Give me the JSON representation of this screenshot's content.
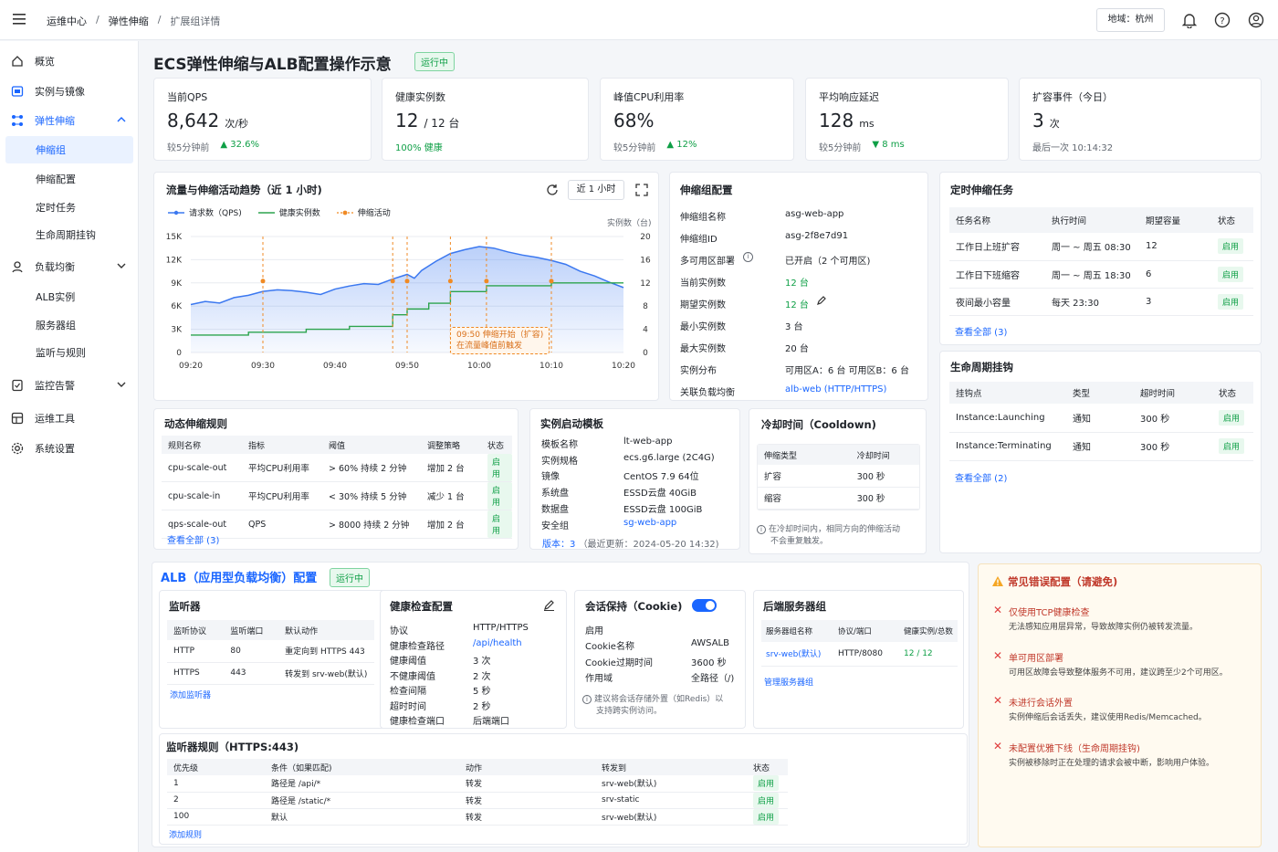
{
  "header": {
    "breadcrumb": [
      "运维中心",
      "弹性伸缩",
      "扩展组详情"
    ],
    "region": "地域：杭州"
  },
  "sidebar": {
    "items": [
      {
        "label": "概览",
        "icon": "overview-icon"
      },
      {
        "label": "实例与镜像",
        "icon": "instance-icon"
      },
      {
        "label": "弹性伸缩",
        "icon": "scaling-icon"
      },
      {
        "label": "伸缩组",
        "sub": true
      },
      {
        "label": "伸缩配置",
        "sub": true
      },
      {
        "label": "定时任务",
        "sub": true
      },
      {
        "label": "生命周期挂钩",
        "sub": true
      },
      {
        "label": "负载均衡",
        "icon": "lb-icon"
      },
      {
        "label": "ALB实例",
        "sub": true
      },
      {
        "label": "服务器组",
        "sub": true
      },
      {
        "label": "监听与规则",
        "sub": true
      },
      {
        "label": "监控告警",
        "icon": "monitor-icon"
      },
      {
        "label": "运维工具",
        "icon": "tools-icon"
      },
      {
        "label": "系统设置",
        "icon": "settings-icon"
      }
    ]
  },
  "page": {
    "title": "ECS弹性伸缩与ALB配置操作示意",
    "status": "运行中"
  },
  "kpis": [
    {
      "label": "当前QPS",
      "value": "8,642",
      "unit": "次/秒",
      "sub": "较5分钟前",
      "trend": "▲ 32.6%",
      "trend_color": "#0e9f46"
    },
    {
      "label": "健康实例数",
      "value": "12",
      "value2": "/  12  台",
      "sub": "100% 健康",
      "trend": "",
      "trend_color": "#0e9f46"
    },
    {
      "label": "峰值CPU利用率",
      "value": "68%",
      "unit": "",
      "sub": "较5分钟前",
      "trend": "▲ 12%",
      "trend_color": "#0e9f46"
    },
    {
      "label": "平均响应延迟",
      "value": "128",
      "unit": "ms",
      "sub": "较5分钟前",
      "trend": "▼ 8 ms",
      "trend_color": "#0e9f46"
    },
    {
      "label": "扩容事件（今日）",
      "value": "3",
      "unit": "次",
      "sub": "最后一次  10:14:32",
      "trend": "",
      "trend_color": "#0e9f46"
    }
  ],
  "chart_card": {
    "title": "流量与伸缩活动趋势（近 1 小时)",
    "range": "近 1 小时",
    "legend": [
      "请求数（QPS)",
      "健康实例数",
      "伸缩活动"
    ],
    "right_axis_title": "实例数（台)",
    "annotation_line1": "09:50 伸缩开始（扩容)",
    "annotation_line2": "在流量峰值前触发"
  },
  "chart_data": {
    "type": "line",
    "x": [
      "09:20",
      "09:30",
      "09:40",
      "09:50",
      "10:00",
      "10:10",
      "10:20"
    ],
    "ylim": [
      0,
      15000
    ],
    "y2lim": [
      0,
      20
    ],
    "yticks": [
      "15K",
      "12K",
      "9K",
      "6K",
      "3K",
      "0"
    ],
    "y2ticks": [
      "20",
      "16",
      "12",
      "8",
      "4",
      "0"
    ],
    "series": [
      {
        "name": "请求数（QPS)",
        "color": "#3b78f0",
        "axis": "left",
        "points": [
          [
            0,
            6200
          ],
          [
            2,
            6600
          ],
          [
            4,
            6400
          ],
          [
            6,
            7100
          ],
          [
            8,
            7400
          ],
          [
            10,
            7900
          ],
          [
            12,
            8100
          ],
          [
            14,
            8000
          ],
          [
            16,
            7800
          ],
          [
            18,
            7500
          ],
          [
            20,
            8200
          ],
          [
            22,
            8600
          ],
          [
            24,
            8900
          ],
          [
            26,
            8800
          ],
          [
            28,
            9500
          ],
          [
            30,
            10100
          ],
          [
            31,
            9600
          ],
          [
            32,
            10600
          ],
          [
            34,
            11800
          ],
          [
            36,
            12800
          ],
          [
            38,
            13300
          ],
          [
            40,
            13700
          ],
          [
            42,
            13500
          ],
          [
            44,
            13000
          ],
          [
            46,
            12600
          ],
          [
            48,
            12300
          ],
          [
            50,
            11900
          ],
          [
            52,
            11400
          ],
          [
            54,
            10500
          ],
          [
            56,
            9900
          ],
          [
            58,
            9100
          ],
          [
            60,
            8400
          ]
        ]
      },
      {
        "name": "健康实例数",
        "color": "#2da44e",
        "axis": "right",
        "points": [
          [
            0,
            3
          ],
          [
            8,
            3
          ],
          [
            8,
            3.5
          ],
          [
            16,
            3.5
          ],
          [
            16,
            4
          ],
          [
            22,
            4
          ],
          [
            22,
            4.5
          ],
          [
            28,
            4.5
          ],
          [
            28,
            6.5
          ],
          [
            30,
            6.5
          ],
          [
            30,
            7.5
          ],
          [
            33,
            7.5
          ],
          [
            33,
            8.5
          ],
          [
            36,
            8.5
          ],
          [
            36,
            10.5
          ],
          [
            41,
            10.5
          ],
          [
            41,
            11.5
          ],
          [
            50,
            11.5
          ],
          [
            50,
            12
          ],
          [
            60,
            12
          ]
        ]
      }
    ],
    "events": [
      {
        "x": 10,
        "label": "伸缩活动"
      },
      {
        "x": 28
      },
      {
        "x": 30
      },
      {
        "x": 36
      },
      {
        "x": 41
      },
      {
        "x": 50
      }
    ]
  },
  "asg": {
    "title": "伸缩组配置",
    "rows": [
      {
        "k": "伸缩组名称",
        "v": "asg-web-app"
      },
      {
        "k": "伸缩组ID",
        "v": "asg-2f8e7d91"
      },
      {
        "k": "多可用区部署",
        "v": "已开启（2 个可用区)"
      },
      {
        "k": "当前实例数",
        "v": "12  台"
      },
      {
        "k": "期望实例数",
        "v": "12  台"
      },
      {
        "k": "最小实例数",
        "v": "3  台"
      },
      {
        "k": "最大实例数",
        "v": "20  台"
      },
      {
        "k": "实例分布",
        "v": "可用区A：6 台   可用区B：6 台"
      },
      {
        "k": "关联负载均衡",
        "v": "alb-web (HTTP/HTTPS)"
      }
    ]
  },
  "scheduled": {
    "title": "定时伸缩任务",
    "headers": [
      "任务名称",
      "执行时间",
      "期望容量",
      "状态"
    ],
    "rows": [
      [
        "工作日上班扩容",
        "周一 ~ 周五 08:30",
        "12",
        "启用"
      ],
      [
        "工作日下班缩容",
        "周一 ~ 周五 18:30",
        "6",
        "启用"
      ],
      [
        "夜间最小容量",
        "每天  23:30",
        "3",
        "启用"
      ]
    ],
    "more": "查看全部  (3)"
  },
  "lifecycle": {
    "title": "生命周期挂钩",
    "headers": [
      "挂钩点",
      "类型",
      "超时时间",
      "状态"
    ],
    "rows": [
      [
        "Instance:Launching",
        "通知",
        "300 秒",
        "启用"
      ],
      [
        "Instance:Terminating",
        "通知",
        "300 秒",
        "启用"
      ]
    ],
    "more": "查看全部  (2)"
  },
  "dyn_rules": {
    "title": "动态伸缩规则",
    "headers": [
      "规则名称",
      "指标",
      "阈值",
      "调整策略",
      "状态"
    ],
    "rows": [
      [
        "cpu-scale-out",
        "平均CPU利用率",
        "> 60% 持续 2 分钟",
        "增加 2 台",
        "启用"
      ],
      [
        "cpu-scale-in",
        "平均CPU利用率",
        "< 30% 持续 5 分钟",
        "减少 1 台",
        "启用"
      ],
      [
        "qps-scale-out",
        "QPS",
        "> 8000 持续 2 分钟",
        "增加 2 台",
        "启用"
      ]
    ],
    "more": "查看全部  (3)"
  },
  "template": {
    "title": "实例启动模板",
    "rows": [
      {
        "k": "模板名称",
        "v": "lt-web-app"
      },
      {
        "k": "实例规格",
        "v": "ecs.g6.large (2C4G)"
      },
      {
        "k": "镜像",
        "v": "CentOS 7.9 64位"
      },
      {
        "k": "系统盘",
        "v": "ESSD云盘 40GiB"
      },
      {
        "k": "数据盘",
        "v": "ESSD云盘 100GiB"
      },
      {
        "k": "安全组",
        "v": "sg-web-app"
      }
    ],
    "version": "版本：3",
    "updated": "（最近更新：2024-05-20 14:32)"
  },
  "cooldown": {
    "title": "冷却时间（Cooldown)",
    "headers": [
      "伸缩类型",
      "冷却时间"
    ],
    "rows": [
      [
        "扩容",
        "300 秒"
      ],
      [
        "缩容",
        "300 秒"
      ]
    ],
    "note1": "在冷却时间内，相同方向的伸缩活动",
    "note2": "不会重复触发。"
  },
  "alb": {
    "title": "ALB（应用型负载均衡）配置",
    "status": "运行中",
    "listener": {
      "title": "监听器",
      "headers": [
        "监听协议",
        "监听端口",
        "默认动作"
      ],
      "rows": [
        [
          "HTTP",
          "80",
          "重定向到 HTTPS 443"
        ],
        [
          "HTTPS",
          "443",
          "转发到 srv-web(默认)"
        ]
      ],
      "add": "添加监听器"
    },
    "health": {
      "title": "健康检查配置",
      "rows": [
        {
          "k": "协议",
          "v": "HTTP/HTTPS"
        },
        {
          "k": "健康检查路径",
          "v": "/api/health"
        },
        {
          "k": "健康阈值",
          "v": "3 次"
        },
        {
          "k": "不健康阈值",
          "v": "2 次"
        },
        {
          "k": "检查间隔",
          "v": "5 秒"
        },
        {
          "k": "超时时间",
          "v": "2 秒"
        },
        {
          "k": "健康检查端口",
          "v": "后端端口"
        }
      ]
    },
    "session": {
      "title": "会话保持（Cookie)",
      "rows": [
        {
          "k": "启用",
          "v": ""
        },
        {
          "k": "Cookie名称",
          "v": "AWSALB"
        },
        {
          "k": "Cookie过期时间",
          "v": "3600 秒"
        },
        {
          "k": "作用域",
          "v": "全路径（/)"
        }
      ],
      "note1": "建议将会话存储外置（如Redis）以",
      "note2": "支持跨实例访问。"
    },
    "backend": {
      "title": "后端服务器组",
      "headers": [
        "服务器组名称",
        "协议/端口",
        "健康实例/总数"
      ],
      "rows": [
        [
          "srv-web(默认)",
          "HTTP/8080",
          "12 / 12"
        ]
      ],
      "manage": "管理服务器组"
    },
    "rules": {
      "title": "监听器规则（HTTPS:443)",
      "headers": [
        "优先级",
        "条件（如果匹配)",
        "动作",
        "转发到",
        "状态"
      ],
      "rows": [
        [
          "1",
          "路径是  /api/*",
          "转发",
          "srv-web(默认)",
          "启用"
        ],
        [
          "2",
          "路径是  /static/*",
          "转发",
          "srv-static",
          "启用"
        ],
        [
          "100",
          "默认",
          "转发",
          "srv-web(默认)",
          "启用"
        ]
      ],
      "add": "添加规则"
    }
  },
  "errors": {
    "title": "常见错误配置（请避免)",
    "items": [
      {
        "t": "仅使用TCP健康检查",
        "d": "无法感知应用层异常，导致故障实例仍被转发流量。"
      },
      {
        "t": "单可用区部署",
        "d": "可用区故障会导致整体服务不可用，建议跨至少2个可用区。"
      },
      {
        "t": "未进行会话外置",
        "d": "实例伸缩后会话丢失，建议使用Redis/Memcached。"
      },
      {
        "t": "未配置优雅下线（生命周期挂钩)",
        "d": "实例被移除时正在处理的请求会被中断，影响用户体验。"
      }
    ]
  }
}
